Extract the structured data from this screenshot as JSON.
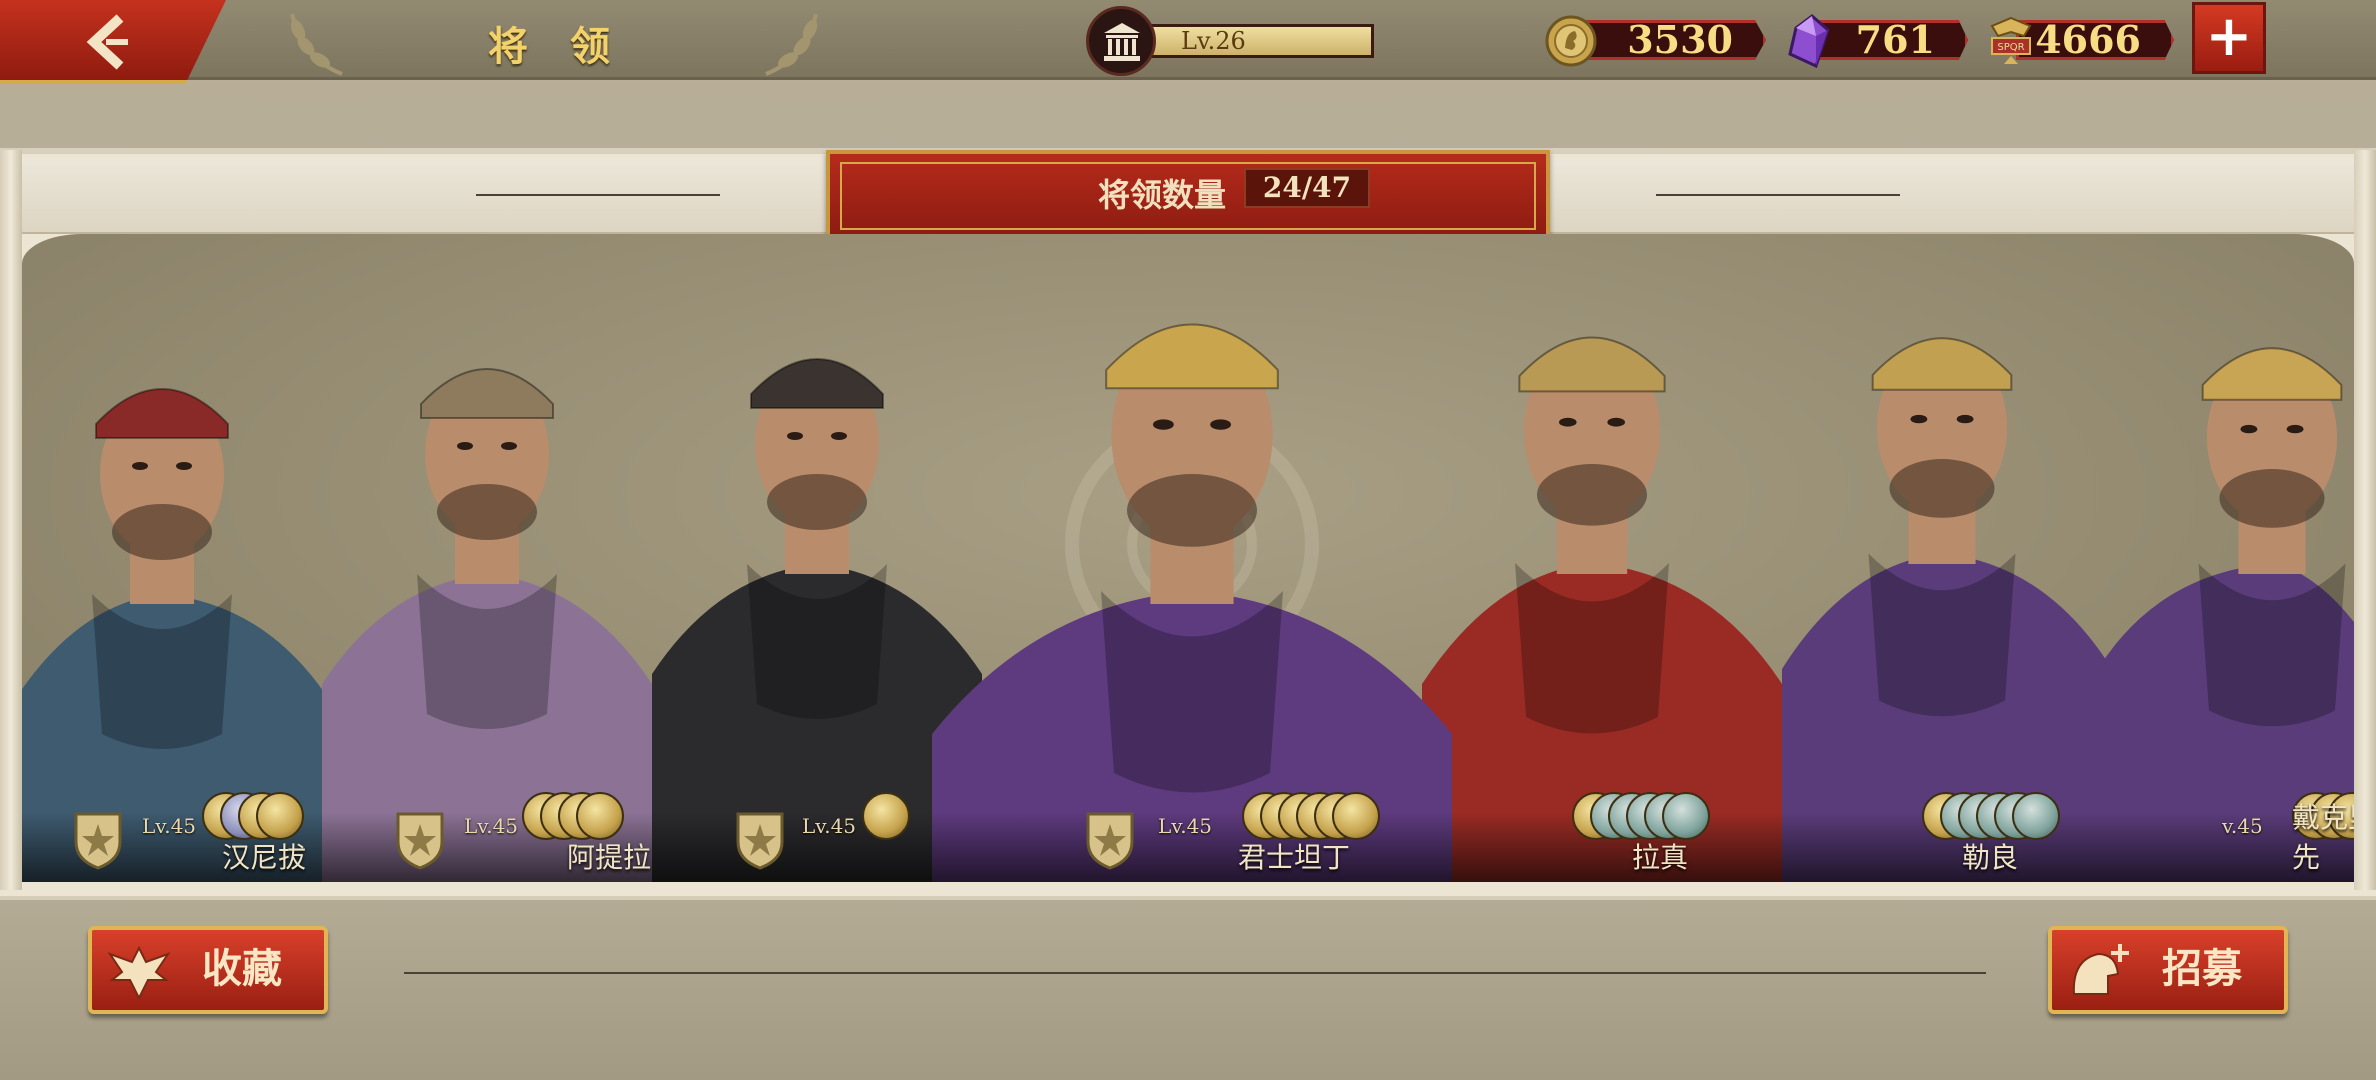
{
  "header": {
    "title": "将 领",
    "level": "Lv.26"
  },
  "resources": [
    {
      "name": "gold",
      "icon": "gold-coin-icon",
      "value": "3530"
    },
    {
      "name": "gem",
      "icon": "purple-gem-icon",
      "value": "761"
    },
    {
      "name": "spqr",
      "icon": "spqr-eagle-icon",
      "value": "4666"
    }
  ],
  "general_count": {
    "label": "将领数量",
    "value": "24/47"
  },
  "generals": [
    {
      "name": "汉尼拔",
      "level": "Lv.45",
      "coin_count": 4,
      "colors": {
        "cloak": "#3e5b70",
        "helm": "#8a2a28"
      }
    },
    {
      "name": "阿提拉",
      "level": "Lv.45",
      "coin_count": 4,
      "colors": {
        "cloak": "#8c7396",
        "helm": "#8e7a5c"
      }
    },
    {
      "name": "",
      "level": "Lv.45",
      "coin_count": 1,
      "colors": {
        "cloak": "#2b2b2e",
        "helm": "#3a3330"
      }
    },
    {
      "name": "君士坦丁",
      "level": "Lv.45",
      "coin_count": 6,
      "colors": {
        "cloak": "#5e3a7e",
        "helm": "#c9a64d"
      }
    },
    {
      "name": "拉真",
      "level": "",
      "coin_count": 6,
      "colors": {
        "cloak": "#9a2b24",
        "helm": "#b89a55"
      }
    },
    {
      "name": "勒良",
      "level": "",
      "coin_count": 6,
      "colors": {
        "cloak": "#5a3c7a",
        "helm": "#c2a052"
      }
    },
    {
      "name": "戴克里先",
      "level": "v.45",
      "coin_count": 3,
      "colors": {
        "cloak": "#5a3c7a",
        "helm": "#c8a455"
      }
    }
  ],
  "buttons": {
    "collection": "收藏",
    "recruit": "招募"
  }
}
